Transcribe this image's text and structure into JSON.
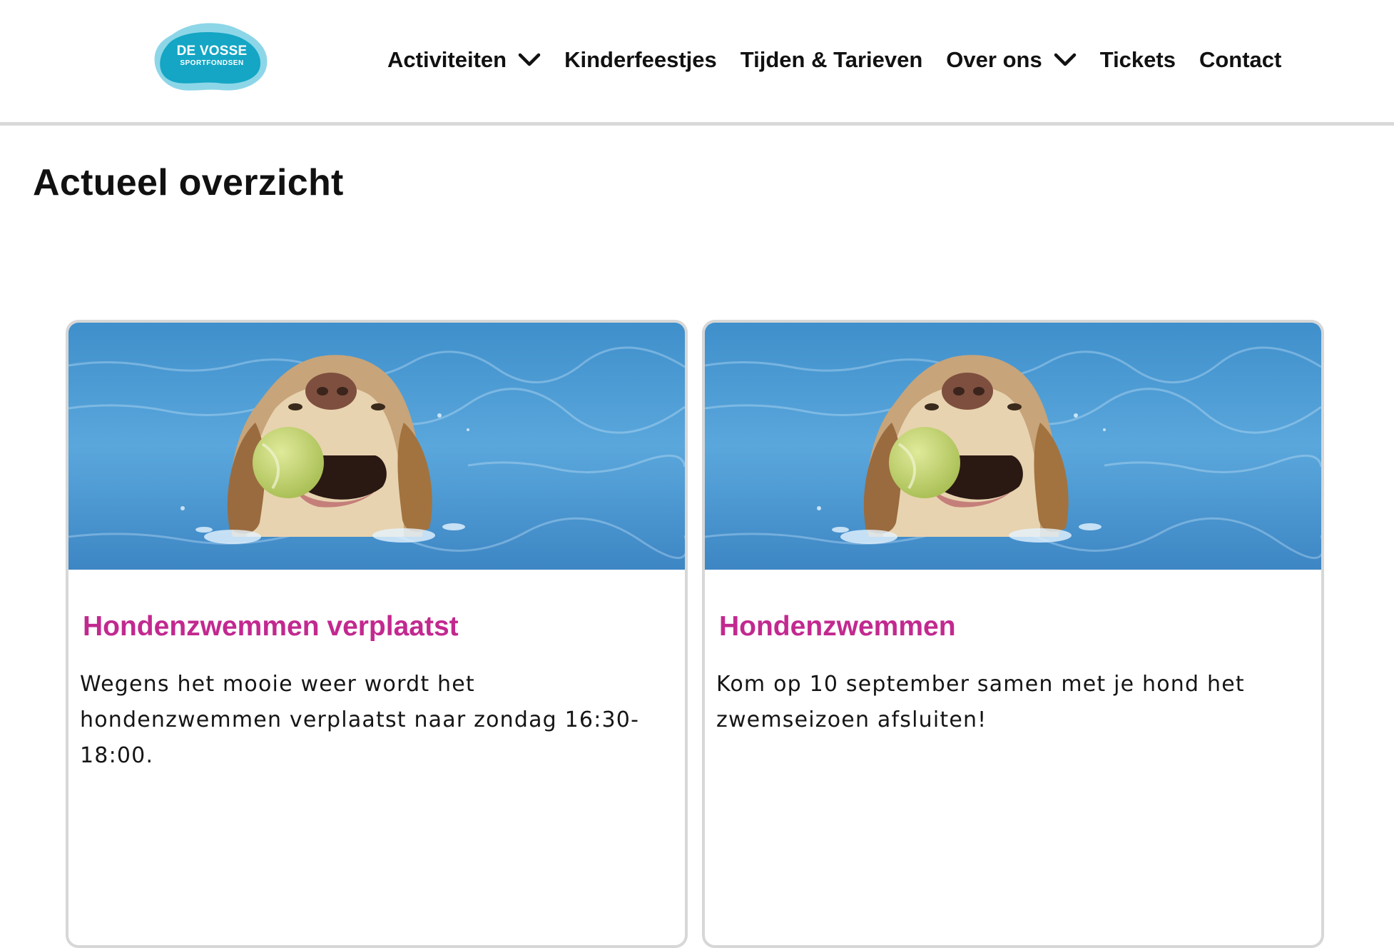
{
  "header": {
    "logo": {
      "title": "DE VOSSE",
      "subtitle": "SPORTFONDSEN",
      "color_primary": "#14a6c4",
      "color_secondary": "#8dd6e8"
    },
    "nav": [
      {
        "label": "Activiteiten",
        "has_dropdown": true
      },
      {
        "label": "Kinderfeestjes",
        "has_dropdown": false
      },
      {
        "label": "Tijden & Tarieven",
        "has_dropdown": false
      },
      {
        "label": "Over ons",
        "has_dropdown": true
      },
      {
        "label": "Tickets",
        "has_dropdown": false
      },
      {
        "label": "Contact",
        "has_dropdown": false
      }
    ]
  },
  "main": {
    "title": "Actueel overzicht",
    "cards": [
      {
        "image": "dog-swimming-with-tennis-ball",
        "title": "Hondenzwemmen verplaatst",
        "text": "Wegens het mooie weer wordt het hondenzwemmen verplaatst naar zondag 16:30-18:00."
      },
      {
        "image": "dog-swimming-with-tennis-ball",
        "title": "Hondenzwemmen",
        "text": "Kom op 10 september samen met je hond het zwemseizoen afsluiten!"
      }
    ]
  },
  "colors": {
    "accent": "#c2298f",
    "text": "#111111",
    "border": "#d7d7d7"
  }
}
